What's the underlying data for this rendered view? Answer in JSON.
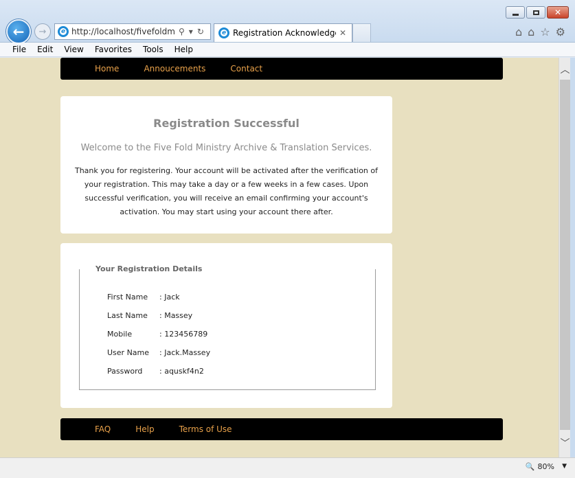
{
  "browser": {
    "url": "http://localhost/fivefoldmin",
    "tab_title": "Registration Acknowledge...",
    "menu": [
      "File",
      "Edit",
      "View",
      "Favorites",
      "Tools",
      "Help"
    ],
    "zoom": "80%"
  },
  "site_nav": {
    "items": [
      "Home",
      "Annoucements",
      "Contact"
    ]
  },
  "confirmation": {
    "title": "Registration Successful",
    "welcome": "Welcome to the Five Fold Ministry Archive & Translation Services.",
    "message": "Thank you for registering. Your account will be activated after the verification of your registration. This may take a day or a few weeks in a few cases. Upon successful verification, you will receive an email confirming your account's activation. You may start using your account there after."
  },
  "details": {
    "legend": "Your Registration Details",
    "rows": [
      {
        "label": "First Name",
        "value": ": Jack"
      },
      {
        "label": "Last Name",
        "value": ": Massey"
      },
      {
        "label": "Mobile",
        "value": ": 123456789"
      },
      {
        "label": "User Name",
        "value": ": Jack.Massey"
      },
      {
        "label": "Password",
        "value": ": aquskf4n2"
      }
    ]
  },
  "footer_nav": {
    "items": [
      "FAQ",
      "Help",
      "Terms of Use"
    ]
  },
  "colors": {
    "page_bg": "#e8e0c0",
    "nav_bg": "#000000",
    "nav_link": "#e8a14a"
  }
}
